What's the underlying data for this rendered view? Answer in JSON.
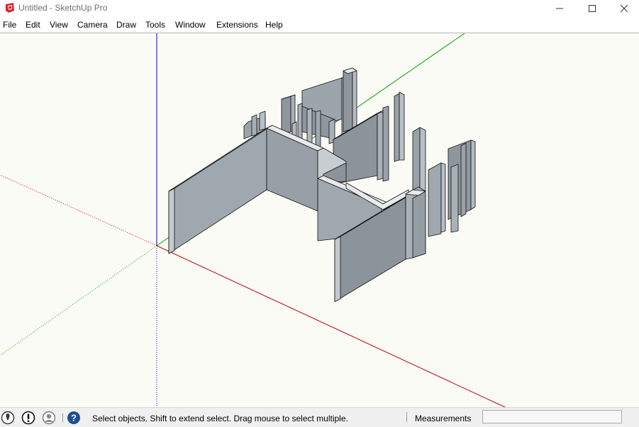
{
  "window": {
    "title": "Untitled - SketchUp Pro"
  },
  "menu": {
    "items": [
      "File",
      "Edit",
      "View",
      "Camera",
      "Draw",
      "Tools",
      "Window",
      "Extensions",
      "Help"
    ]
  },
  "status": {
    "message": "Select objects. Shift to extend select. Drag mouse to select multiple.",
    "measurements_label": "Measurements",
    "measurements_value": ""
  },
  "icons": {
    "app": "sketchup-logo-icon",
    "geo": "geo-location-icon",
    "credits": "credits-icon",
    "user": "user-account-icon",
    "help": "instructor-help-icon"
  },
  "colors": {
    "axis_red": "#c00000",
    "axis_green": "#00a000",
    "axis_blue": "#0000c8",
    "wall_light": "#a6aeb5",
    "wall_dark": "#8c949b",
    "wall_top": "#e8eaec",
    "viewport_bg": "#fbfbf6"
  }
}
